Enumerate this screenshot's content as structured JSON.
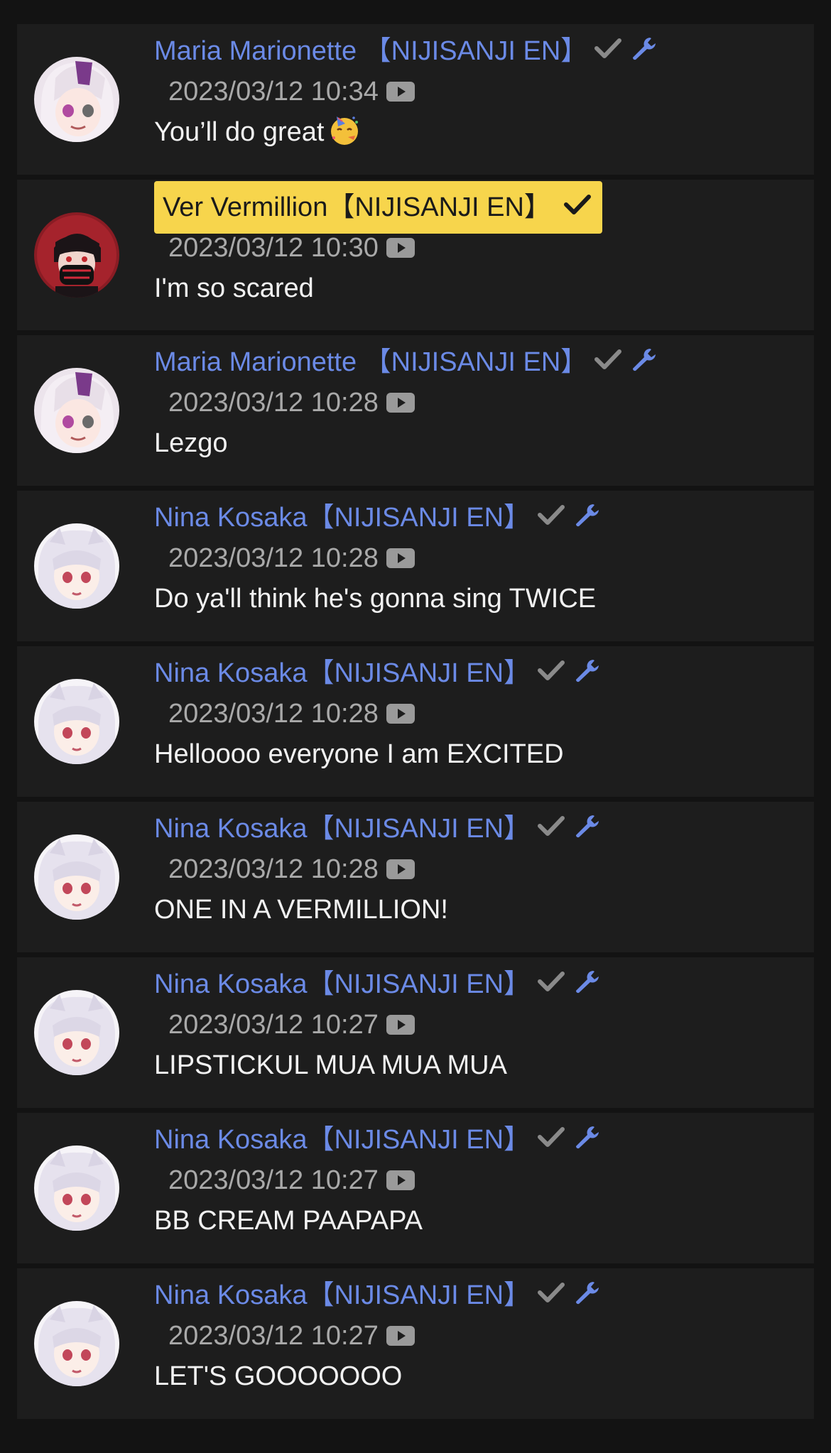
{
  "messages": [
    {
      "author": "Maria Marionette 【NIJISANJI EN】",
      "avatar": "maria",
      "badges": [
        "check",
        "wrench"
      ],
      "timestamp": "2023/03/12 10:34",
      "text": "You’ll do great",
      "emoji": "partying-face",
      "owner": false
    },
    {
      "author": "Ver Vermillion【NIJISANJI EN】",
      "avatar": "ver",
      "badges": [
        "check"
      ],
      "timestamp": "2023/03/12 10:30",
      "text": "I'm so scared",
      "owner": true
    },
    {
      "author": "Maria Marionette 【NIJISANJI EN】",
      "avatar": "maria",
      "badges": [
        "check",
        "wrench"
      ],
      "timestamp": "2023/03/12 10:28",
      "text": "Lezgo",
      "owner": false
    },
    {
      "author": "Nina Kosaka【NIJISANJI EN】",
      "avatar": "nina",
      "badges": [
        "check",
        "wrench"
      ],
      "timestamp": "2023/03/12 10:28",
      "text": "Do ya'll think he's gonna sing TWICE",
      "owner": false
    },
    {
      "author": "Nina Kosaka【NIJISANJI EN】",
      "avatar": "nina",
      "badges": [
        "check",
        "wrench"
      ],
      "timestamp": "2023/03/12 10:28",
      "text": "Helloooo everyone I am EXCITED",
      "owner": false
    },
    {
      "author": "Nina Kosaka【NIJISANJI EN】",
      "avatar": "nina",
      "badges": [
        "check",
        "wrench"
      ],
      "timestamp": "2023/03/12 10:28",
      "text": "ONE IN A VERMILLION!",
      "owner": false
    },
    {
      "author": "Nina Kosaka【NIJISANJI EN】",
      "avatar": "nina",
      "badges": [
        "check",
        "wrench"
      ],
      "timestamp": "2023/03/12 10:27",
      "text": "LIPSTICKUL MUA MUA MUA",
      "owner": false
    },
    {
      "author": "Nina Kosaka【NIJISANJI EN】",
      "avatar": "nina",
      "badges": [
        "check",
        "wrench"
      ],
      "timestamp": "2023/03/12 10:27",
      "text": "BB CREAM PAAPAPA",
      "owner": false
    },
    {
      "author": "Nina Kosaka【NIJISANJI EN】",
      "avatar": "nina",
      "badges": [
        "check",
        "wrench"
      ],
      "timestamp": "2023/03/12 10:27",
      "text": "LET'S GOOOOOOO",
      "owner": false
    }
  ],
  "colors": {
    "background": "#131313",
    "card": "#1d1d1d",
    "member_name": "#6b8ae6",
    "owner_highlight": "#f7d54c",
    "timestamp": "#a9a9a9",
    "message_text": "#f2f2f2",
    "verified_check": "#8a8a8a",
    "moderator_wrench": "#6b8ae6"
  },
  "icons": {
    "verified": "check-icon",
    "moderator": "wrench-icon",
    "source": "youtube-icon"
  }
}
